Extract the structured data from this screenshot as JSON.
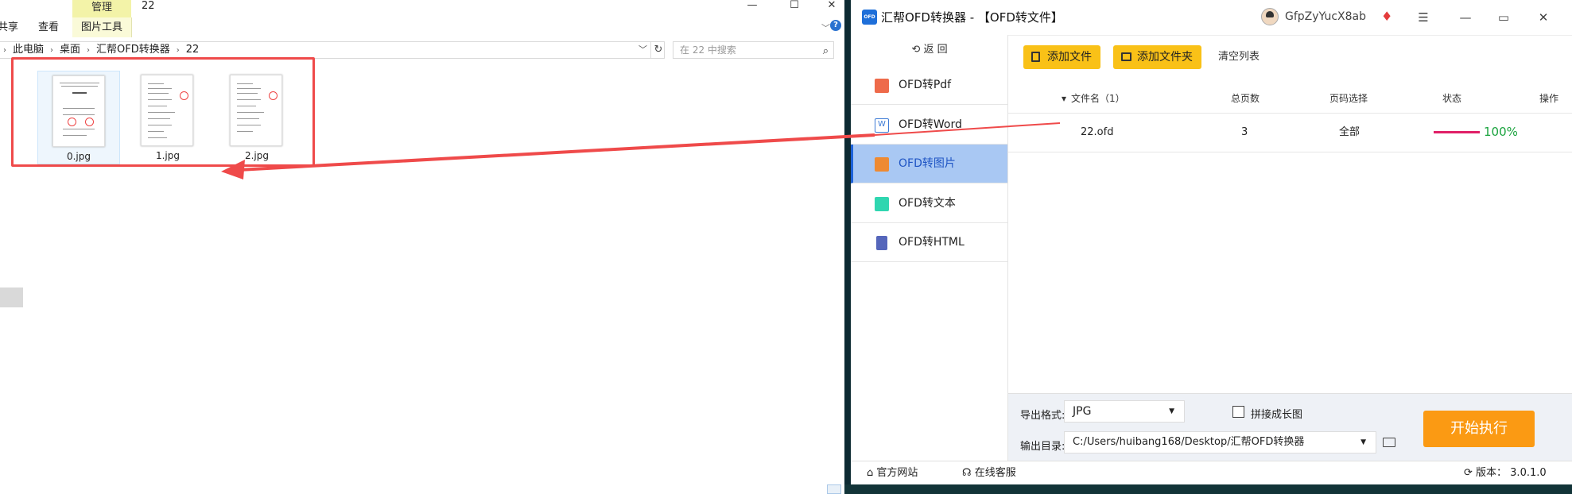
{
  "explorer": {
    "ribbon": {
      "manage": "管理",
      "picture_tools": "图片工具",
      "share": "共享",
      "view": "查看"
    },
    "window_title": "22",
    "window_controls": {
      "minimize": "—",
      "maximize": "☐",
      "close": "✕"
    },
    "breadcrumb": [
      "此电脑",
      "桌面",
      "汇帮OFD转换器",
      "22"
    ],
    "search_placeholder": "在 22 中搜索",
    "files": [
      {
        "name": "0.jpg",
        "selected": true
      },
      {
        "name": "1.jpg",
        "selected": false
      },
      {
        "name": "2.jpg",
        "selected": false
      }
    ]
  },
  "app": {
    "title": "汇帮OFD转换器 - 【OFD转文件】",
    "logo": "OFD",
    "username": "GfpZyYucX8ab",
    "back_label": "返 回",
    "nav": [
      {
        "label": "OFD转Pdf",
        "icon": "pdf-icon",
        "color": "#ee6a4a",
        "active": false
      },
      {
        "label": "OFD转Word",
        "icon": "word-icon",
        "color": "#3d7bd6",
        "active": false
      },
      {
        "label": "OFD转图片",
        "icon": "image-icon",
        "color": "#ee8a32",
        "active": true
      },
      {
        "label": "OFD转文本",
        "icon": "text-icon",
        "color": "#2fd6b0",
        "active": false
      },
      {
        "label": "OFD转HTML",
        "icon": "html-icon",
        "color": "#5566bb",
        "active": false
      }
    ],
    "toolbar": {
      "add_file": "添加文件",
      "add_folder": "添加文件夹",
      "clear_list": "清空列表"
    },
    "table": {
      "headers": {
        "name": "文件名（1）",
        "pages": "总页数",
        "page_select": "页码选择",
        "status": "状态",
        "action": "操作"
      },
      "rows": [
        {
          "name": "22.ofd",
          "pages": "3",
          "page_select": "全部",
          "progress_pct": 100,
          "status": "100%"
        }
      ]
    },
    "settings": {
      "format_label": "导出格式:",
      "format_value": "JPG",
      "stitch_label": "拼接成长图",
      "stitch_checked": false,
      "dir_label": "输出目录:",
      "dir_value": "C:/Users/huibang168/Desktop/汇帮OFD转换器"
    },
    "start_label": "开始执行",
    "statusbar": {
      "website": "官方网站",
      "support": "在线客服",
      "version": "版本： 3.0.1.0"
    },
    "colors": {
      "accent_yellow": "#f9c117",
      "start_orange": "#fb9a13",
      "nav_active": "#a9c8f3",
      "progress": "#e01f67",
      "annotation_red": "#ef4a4a"
    }
  }
}
